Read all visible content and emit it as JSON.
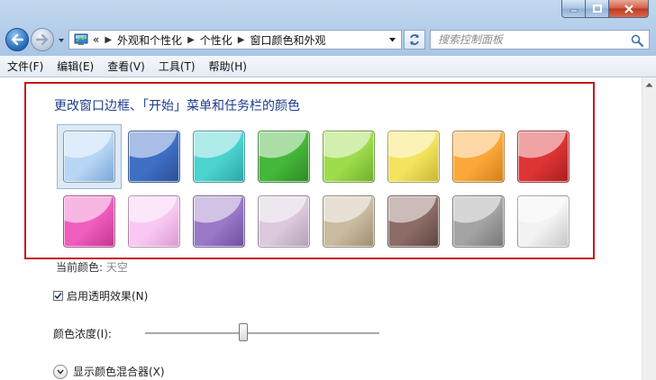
{
  "breadcrumb": {
    "overflow": "«",
    "items": [
      "外观和个性化",
      "个性化",
      "窗口颜色和外观"
    ]
  },
  "search": {
    "placeholder": "搜索控制面板"
  },
  "menu": [
    "文件(F)",
    "编辑(E)",
    "查看(V)",
    "工具(T)",
    "帮助(H)"
  ],
  "section": {
    "title": "更改窗口边框、「开始」菜单和任务栏的颜色"
  },
  "swatches": [
    {
      "color": "#b7d6f5",
      "edge": "#7aa6d8",
      "selected": true
    },
    {
      "color": "#3f6fc4",
      "edge": "#2a4f98"
    },
    {
      "color": "#4cd3cf",
      "edge": "#2aa6a3"
    },
    {
      "color": "#45b73a",
      "edge": "#2e8a26"
    },
    {
      "color": "#9edc4c",
      "edge": "#6fae2c"
    },
    {
      "color": "#f3e35f",
      "edge": "#c9b631"
    },
    {
      "color": "#fba83a",
      "edge": "#d27e17"
    },
    {
      "color": "#dd3434",
      "edge": "#a81f1f"
    },
    {
      "color": "#ef5dbe",
      "edge": "#c23592"
    },
    {
      "color": "#f9c8f2",
      "edge": "#d99ad0"
    },
    {
      "color": "#9a79c8",
      "edge": "#6e4f9e"
    },
    {
      "color": "#dcc9dd",
      "edge": "#b49fb6"
    },
    {
      "color": "#c9bba0",
      "edge": "#9d8e70"
    },
    {
      "color": "#8c6c66",
      "edge": "#5e4540"
    },
    {
      "color": "#a4a4a4",
      "edge": "#777777"
    },
    {
      "color": "#f2f2f2",
      "edge": "#c6c6c6"
    }
  ],
  "current_color": {
    "label": "当前颜色:",
    "value": "天空"
  },
  "transparency": {
    "label": "启用透明效果(N)",
    "checked": true
  },
  "intensity": {
    "label": "颜色浓度(I):",
    "value": 0.42
  },
  "mixer": {
    "label": "显示颜色混合器(X)"
  }
}
